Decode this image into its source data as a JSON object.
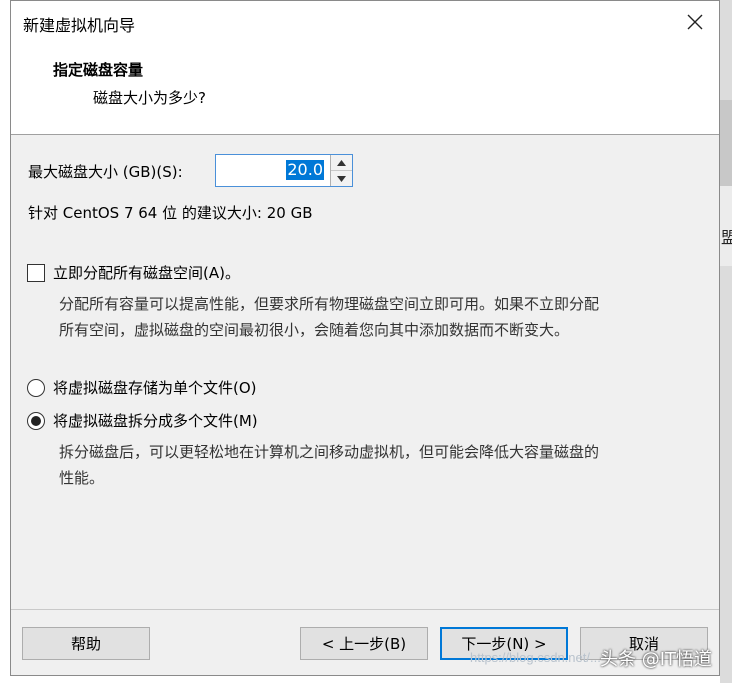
{
  "window": {
    "title": "新建虚拟机向导",
    "heading": "指定磁盘容量",
    "subheading": "磁盘大小为多少?"
  },
  "disk": {
    "size_label": "最大磁盘大小 (GB)(S):",
    "size_value": "20.0",
    "recommend_text": "针对 CentOS 7 64 位 的建议大小: 20 GB"
  },
  "allocate": {
    "label": "立即分配所有磁盘空间(A)。",
    "checked": false,
    "description_line1": "分配所有容量可以提高性能，但要求所有物理磁盘空间立即可用。如果不立即分配",
    "description_line2": "所有空间，虚拟磁盘的空间最初很小，会随着您向其中添加数据而不断变大。"
  },
  "storage": {
    "single_label": "将虚拟磁盘存储为单个文件(O)",
    "multi_label": "将虚拟磁盘拆分成多个文件(M)",
    "selected": "multi",
    "multi_description_line1": "拆分磁盘后，可以更轻松地在计算机之间移动虚拟机，但可能会降低大容量磁盘的",
    "multi_description_line2": "性能。"
  },
  "buttons": {
    "help": "帮助",
    "back": "< 上一步(B)",
    "next": "下一步(N) >",
    "cancel": "取消"
  },
  "overlay": {
    "watermark": "https://blog.csdn.net/...",
    "brand": "头条 @IT悟道",
    "backdrop_glyph": "盟"
  },
  "icons": {
    "close": "close-icon",
    "spin_up": "chevron-up-icon",
    "spin_down": "chevron-down-icon"
  }
}
